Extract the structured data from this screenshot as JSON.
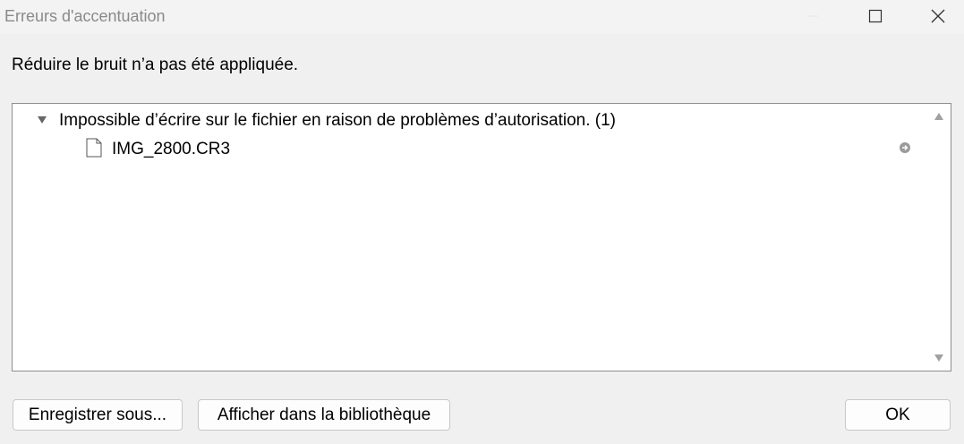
{
  "window": {
    "title": "Erreurs d'accentuation",
    "controls": {
      "minimize_icon": "minimize-icon",
      "maximize_icon": "maximize-icon",
      "close_icon": "close-icon"
    }
  },
  "message": "Réduire le bruit n’a pas été appliquée.",
  "errors": {
    "group_label": "Impossible d’écrire sur le fichier en raison de problèmes d’autorisation. (1)",
    "files": [
      {
        "name": "IMG_2800.CR3",
        "icon": "file-icon",
        "action_icon": "goto-arrow-icon"
      }
    ]
  },
  "buttons": {
    "save_as": "Enregistrer sous...",
    "show_in_library": "Afficher dans la bibliothèque",
    "ok": "OK"
  }
}
